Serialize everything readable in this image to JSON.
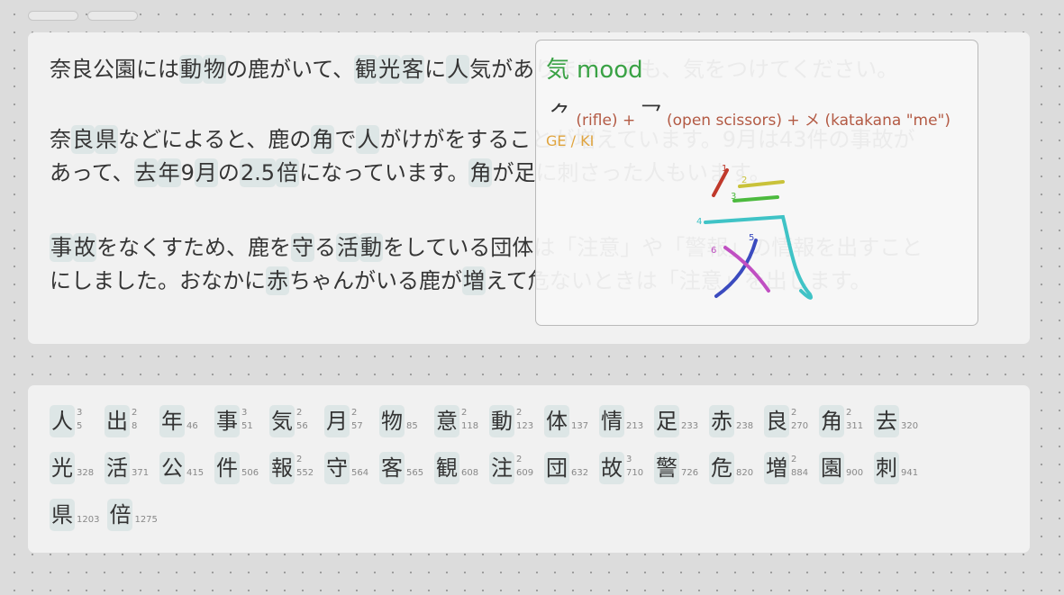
{
  "reading": {
    "paragraphs": [
      [
        [
          {
            "t": "奈良公園",
            "k": false
          },
          {
            "t": "には",
            "k": false
          },
          {
            "t": "動",
            "k": true
          },
          {
            "t": "物",
            "k": true
          },
          {
            "t": "の",
            "k": false
          },
          {
            "t": "鹿",
            "k": false
          },
          {
            "t": "がいて、",
            "k": false
          },
          {
            "t": "観",
            "k": true
          },
          {
            "t": "光",
            "k": true
          },
          {
            "t": "客",
            "k": true
          },
          {
            "t": "に",
            "k": false
          },
          {
            "t": "人",
            "k": true
          },
          {
            "t": "気があります。でも、気をつけてください。",
            "k": false
          }
        ]
      ],
      [
        [
          {
            "t": "奈",
            "k": false
          },
          {
            "t": "良",
            "k": true
          },
          {
            "t": "県",
            "k": true
          },
          {
            "t": "などによると、鹿の",
            "k": false
          },
          {
            "t": "角",
            "k": true
          },
          {
            "t": "で",
            "k": false
          },
          {
            "t": "人",
            "k": true
          },
          {
            "t": "がけがをすることが増えています。9",
            "k": false
          },
          {
            "t": "月",
            "k": false
          },
          {
            "t": "は43件の事故が",
            "k": false
          }
        ],
        [
          {
            "t": "あって、",
            "k": false
          },
          {
            "t": "去",
            "k": true
          },
          {
            "t": "年",
            "k": true
          },
          {
            "t": "9",
            "k": false
          },
          {
            "t": "月",
            "k": true
          },
          {
            "t": "の",
            "k": false
          },
          {
            "t": "2.5",
            "k": true
          },
          {
            "t": "倍",
            "k": true
          },
          {
            "t": "になっています。",
            "k": false
          },
          {
            "t": "角",
            "k": true
          },
          {
            "t": "が足に刺さった人もいます。",
            "k": false
          }
        ]
      ],
      [
        [
          {
            "t": "事",
            "k": true
          },
          {
            "t": "故",
            "k": true
          },
          {
            "t": "をなくすため、鹿を",
            "k": false
          },
          {
            "t": "守",
            "k": true
          },
          {
            "t": "る",
            "k": false
          },
          {
            "t": "活",
            "k": true
          },
          {
            "t": "動",
            "k": true
          },
          {
            "t": "をしている団体は「注意」や「警報」の情報を出すこと",
            "k": false
          }
        ],
        [
          {
            "t": "にしました。おなかに",
            "k": false
          },
          {
            "t": "赤",
            "k": true
          },
          {
            "t": "ちゃんがいる鹿が",
            "k": false
          },
          {
            "t": "増",
            "k": true
          },
          {
            "t": "えて危ないときは「注意」を出します。",
            "k": false
          }
        ]
      ]
    ]
  },
  "popup": {
    "kanji": "気",
    "meaning": "mood",
    "parts": {
      "glyph1": "⺈",
      "part1": "(rifle) +",
      "glyph2": "乛",
      "part2": "(open scissors) + メ (katakana \"me\")"
    },
    "reading": "GE / KI",
    "stroke_numbers": [
      "1",
      "2",
      "3",
      "4",
      "5",
      "6"
    ],
    "stroke_colors": [
      "#c0392b",
      "#c9c23a",
      "#4cba3e",
      "#3fc3c6",
      "#3b4bbf",
      "#c04fc2"
    ]
  },
  "kanji_list": [
    [
      {
        "c": "人",
        "top": "3",
        "num": "5"
      },
      {
        "c": "出",
        "top": "2",
        "num": "8"
      },
      {
        "c": "年",
        "top": "",
        "num": "46"
      },
      {
        "c": "事",
        "top": "3",
        "num": "51"
      },
      {
        "c": "気",
        "top": "2",
        "num": "56"
      },
      {
        "c": "月",
        "top": "2",
        "num": "57"
      },
      {
        "c": "物",
        "top": "",
        "num": "85"
      },
      {
        "c": "意",
        "top": "2",
        "num": "118"
      },
      {
        "c": "動",
        "top": "2",
        "num": "123"
      },
      {
        "c": "体",
        "top": "",
        "num": "137"
      },
      {
        "c": "情",
        "top": "",
        "num": "213"
      },
      {
        "c": "足",
        "top": "",
        "num": "233"
      },
      {
        "c": "赤",
        "top": "",
        "num": "238"
      },
      {
        "c": "良",
        "top": "2",
        "num": "270"
      },
      {
        "c": "角",
        "top": "2",
        "num": "311"
      },
      {
        "c": "去",
        "top": "",
        "num": "320"
      }
    ],
    [
      {
        "c": "光",
        "top": "",
        "num": "328"
      },
      {
        "c": "活",
        "top": "",
        "num": "371"
      },
      {
        "c": "公",
        "top": "",
        "num": "415"
      },
      {
        "c": "件",
        "top": "",
        "num": "506"
      },
      {
        "c": "報",
        "top": "2",
        "num": "552"
      },
      {
        "c": "守",
        "top": "",
        "num": "564"
      },
      {
        "c": "客",
        "top": "",
        "num": "565"
      },
      {
        "c": "観",
        "top": "",
        "num": "608"
      },
      {
        "c": "注",
        "top": "2",
        "num": "609"
      },
      {
        "c": "団",
        "top": "",
        "num": "632"
      },
      {
        "c": "故",
        "top": "3",
        "num": "710"
      },
      {
        "c": "警",
        "top": "",
        "num": "726"
      },
      {
        "c": "危",
        "top": "",
        "num": "820"
      },
      {
        "c": "増",
        "top": "2",
        "num": "884"
      },
      {
        "c": "園",
        "top": "",
        "num": "900"
      },
      {
        "c": "刺",
        "top": "",
        "num": "941"
      }
    ],
    [
      {
        "c": "県",
        "top": "",
        "num": "1203"
      },
      {
        "c": "倍",
        "top": "",
        "num": "1275"
      }
    ]
  ]
}
